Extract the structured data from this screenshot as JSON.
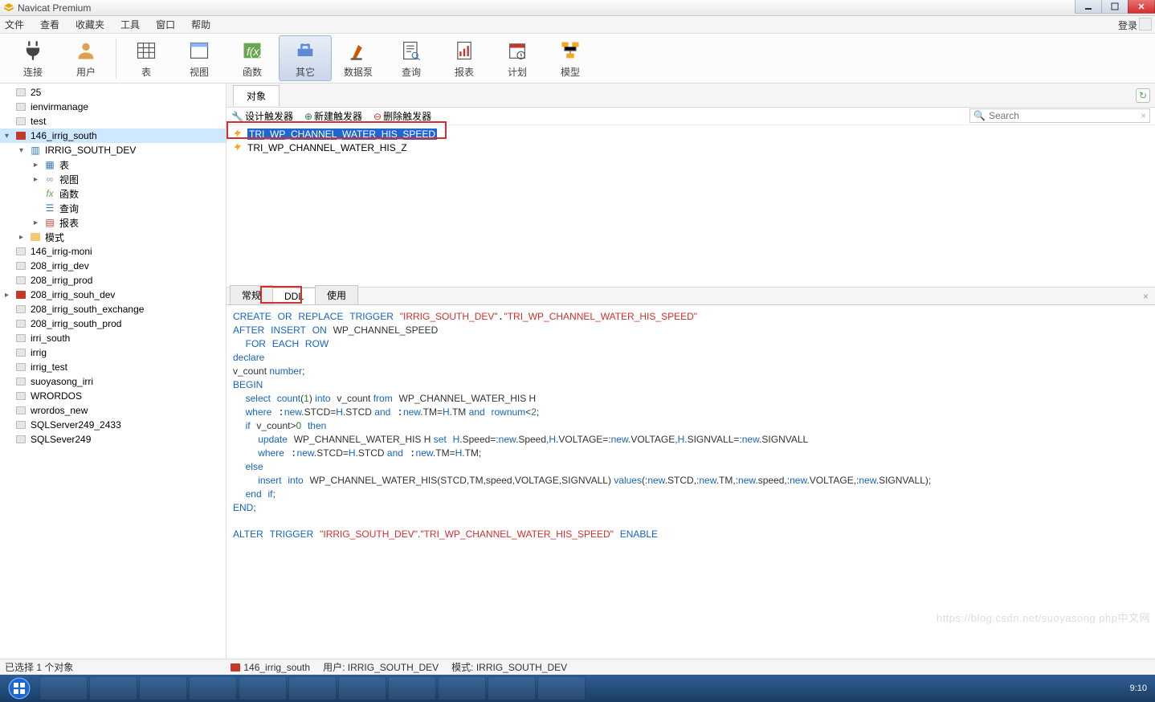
{
  "window": {
    "title": "Navicat Premium"
  },
  "menu": {
    "items": [
      "文件",
      "查看",
      "收藏夹",
      "工具",
      "窗口",
      "帮助"
    ],
    "login": "登录"
  },
  "toolbar": {
    "items": [
      {
        "label": "连接",
        "icon": "plug-icon"
      },
      {
        "label": "用户",
        "icon": "user-icon"
      },
      {
        "label": "表",
        "icon": "table-icon"
      },
      {
        "label": "视图",
        "icon": "view-icon"
      },
      {
        "label": "函数",
        "icon": "fx-icon"
      },
      {
        "label": "其它",
        "icon": "other-icon",
        "active": true
      },
      {
        "label": "数据泵",
        "icon": "pump-icon"
      },
      {
        "label": "查询",
        "icon": "query-icon"
      },
      {
        "label": "报表",
        "icon": "report-icon"
      },
      {
        "label": "计划",
        "icon": "schedule-icon"
      },
      {
        "label": "模型",
        "icon": "model-icon"
      }
    ]
  },
  "sidebar": {
    "items": [
      {
        "label": "25",
        "depth": 0,
        "icon": "db-closed"
      },
      {
        "label": "ienvirmanage",
        "depth": 0,
        "icon": "db-closed"
      },
      {
        "label": "test",
        "depth": 0,
        "icon": "db-closed"
      },
      {
        "label": "146_irrig_south",
        "depth": 0,
        "icon": "db-open",
        "arrow": "▾",
        "selected": true
      },
      {
        "label": "IRRIG_SOUTH_DEV",
        "depth": 1,
        "icon": "schema",
        "arrow": "▾"
      },
      {
        "label": "表",
        "depth": 2,
        "icon": "table",
        "arrow": "▸"
      },
      {
        "label": "视图",
        "depth": 2,
        "icon": "view",
        "arrow": "▸"
      },
      {
        "label": "函数",
        "depth": 2,
        "icon": "fx"
      },
      {
        "label": "查询",
        "depth": 2,
        "icon": "query"
      },
      {
        "label": "报表",
        "depth": 2,
        "icon": "report",
        "arrow": "▸"
      },
      {
        "label": "模式",
        "depth": 1,
        "icon": "folder",
        "arrow": "▸"
      },
      {
        "label": "146_irrig-moni",
        "depth": 0,
        "icon": "db-closed"
      },
      {
        "label": "208_irrig_dev",
        "depth": 0,
        "icon": "db-closed"
      },
      {
        "label": "208_irrig_prod",
        "depth": 0,
        "icon": "db-closed"
      },
      {
        "label": "208_irrig_souh_dev",
        "depth": 0,
        "icon": "db-open",
        "arrow": "▸"
      },
      {
        "label": "208_irrig_south_exchange",
        "depth": 0,
        "icon": "db-closed"
      },
      {
        "label": "208_irrig_south_prod",
        "depth": 0,
        "icon": "db-closed"
      },
      {
        "label": "irri_south",
        "depth": 0,
        "icon": "db-closed"
      },
      {
        "label": "irrig",
        "depth": 0,
        "icon": "db-closed"
      },
      {
        "label": "irrig_test",
        "depth": 0,
        "icon": "db-closed"
      },
      {
        "label": "suoyasong_irri",
        "depth": 0,
        "icon": "db-closed"
      },
      {
        "label": "WRORDOS",
        "depth": 0,
        "icon": "db-closed"
      },
      {
        "label": "wrordos_new",
        "depth": 0,
        "icon": "db-closed"
      },
      {
        "label": "SQLServer249_2433",
        "depth": 0,
        "icon": "db-closed"
      },
      {
        "label": "SQLSever249",
        "depth": 0,
        "icon": "db-closed"
      }
    ]
  },
  "main": {
    "tab": "对象",
    "actions": {
      "design": "设计触发器",
      "new": "新建触发器",
      "delete": "删除触发器"
    },
    "search_placeholder": "Search",
    "triggers": [
      {
        "name": "TRI_WP_CHANNEL_WATER_HIS_SPEED",
        "selected": true
      },
      {
        "name": "TRI_WP_CHANNEL_WATER_HIS_Z",
        "selected": false
      }
    ],
    "detail_tabs": {
      "general": "常规",
      "ddl": "DDL",
      "use": "使用"
    },
    "ddl_tokens": [
      [
        "kw",
        "CREATE"
      ],
      [
        "sp",
        " "
      ],
      [
        "kw",
        "OR"
      ],
      [
        "sp",
        " "
      ],
      [
        "kw",
        "REPLACE"
      ],
      [
        "sp",
        " "
      ],
      [
        "kw",
        "TRIGGER"
      ],
      [
        "sp",
        " "
      ],
      [
        "str",
        "\"IRRIG_SOUTH_DEV\""
      ],
      [
        "sp",
        "."
      ],
      [
        "str",
        "\"TRI_WP_CHANNEL_WATER_HIS_SPEED\""
      ],
      [
        "nl"
      ],
      [
        "kw",
        "AFTER"
      ],
      [
        "sp",
        " "
      ],
      [
        "kw",
        "INSERT"
      ],
      [
        "sp",
        " "
      ],
      [
        "kw",
        "ON"
      ],
      [
        "sp",
        " "
      ],
      [
        "ident",
        "WP_CHANNEL_SPEED"
      ],
      [
        "nl"
      ],
      [
        "sp",
        "  "
      ],
      [
        "kw",
        "FOR"
      ],
      [
        "sp",
        " "
      ],
      [
        "kw",
        "EACH"
      ],
      [
        "sp",
        " "
      ],
      [
        "kw",
        "ROW"
      ],
      [
        "nl"
      ],
      [
        "kw",
        "declare"
      ],
      [
        "nl"
      ],
      [
        "ident",
        "v_count "
      ],
      [
        "kw",
        "number"
      ],
      [
        "ident",
        ";"
      ],
      [
        "nl"
      ],
      [
        "kw",
        "BEGIN"
      ],
      [
        "nl"
      ],
      [
        "sp",
        "  "
      ],
      [
        "kw",
        "select"
      ],
      [
        "sp",
        " "
      ],
      [
        "kw",
        "count"
      ],
      [
        "ident",
        "("
      ],
      [
        "num",
        "1"
      ],
      [
        "ident",
        ") "
      ],
      [
        "kw",
        "into"
      ],
      [
        "sp",
        " "
      ],
      [
        "ident",
        "v_count "
      ],
      [
        "kw",
        "from"
      ],
      [
        "sp",
        " "
      ],
      [
        "ident",
        "WP_CHANNEL_WATER_HIS H"
      ],
      [
        "nl"
      ],
      [
        "sp",
        "  "
      ],
      [
        "kw",
        "where"
      ],
      [
        "sp",
        " :"
      ],
      [
        "kw",
        "new"
      ],
      [
        "ident",
        ".STCD="
      ],
      [
        "kw",
        "H"
      ],
      [
        "ident",
        ".STCD "
      ],
      [
        "kw",
        "and"
      ],
      [
        "sp",
        " :"
      ],
      [
        "kw",
        "new"
      ],
      [
        "ident",
        ".TM="
      ],
      [
        "kw",
        "H"
      ],
      [
        "ident",
        ".TM "
      ],
      [
        "kw",
        "and"
      ],
      [
        "sp",
        " "
      ],
      [
        "kw",
        "rownum"
      ],
      [
        "ident",
        "<"
      ],
      [
        "num",
        "2"
      ],
      [
        "ident",
        ";"
      ],
      [
        "nl"
      ],
      [
        "sp",
        "  "
      ],
      [
        "kw",
        "if"
      ],
      [
        "sp",
        " "
      ],
      [
        "ident",
        "v_count>"
      ],
      [
        "num",
        "0"
      ],
      [
        "sp",
        " "
      ],
      [
        "kw",
        "then"
      ],
      [
        "nl"
      ],
      [
        "sp",
        "    "
      ],
      [
        "kw",
        "update"
      ],
      [
        "sp",
        " "
      ],
      [
        "ident",
        "WP_CHANNEL_WATER_HIS H "
      ],
      [
        "kw",
        "set"
      ],
      [
        "sp",
        " "
      ],
      [
        "kw",
        "H"
      ],
      [
        "ident",
        ".Speed=:"
      ],
      [
        "kw",
        "new"
      ],
      [
        "ident",
        ".Speed,"
      ],
      [
        "kw",
        "H"
      ],
      [
        "ident",
        ".VOLTAGE=:"
      ],
      [
        "kw",
        "new"
      ],
      [
        "ident",
        ".VOLTAGE,"
      ],
      [
        "kw",
        "H"
      ],
      [
        "ident",
        ".SIGNVALL=:"
      ],
      [
        "kw",
        "new"
      ],
      [
        "ident",
        ".SIGNVALL"
      ],
      [
        "nl"
      ],
      [
        "sp",
        "    "
      ],
      [
        "kw",
        "where"
      ],
      [
        "sp",
        " :"
      ],
      [
        "kw",
        "new"
      ],
      [
        "ident",
        ".STCD="
      ],
      [
        "kw",
        "H"
      ],
      [
        "ident",
        ".STCD "
      ],
      [
        "kw",
        "and"
      ],
      [
        "sp",
        " :"
      ],
      [
        "kw",
        "new"
      ],
      [
        "ident",
        ".TM="
      ],
      [
        "kw",
        "H"
      ],
      [
        "ident",
        ".TM;"
      ],
      [
        "nl"
      ],
      [
        "sp",
        "  "
      ],
      [
        "kw",
        "else"
      ],
      [
        "nl"
      ],
      [
        "sp",
        "    "
      ],
      [
        "kw",
        "insert"
      ],
      [
        "sp",
        " "
      ],
      [
        "kw",
        "into"
      ],
      [
        "sp",
        " "
      ],
      [
        "ident",
        "WP_CHANNEL_WATER_HIS(STCD,TM,speed,VOLTAGE,SIGNVALL) "
      ],
      [
        "kw",
        "values"
      ],
      [
        "ident",
        "(:"
      ],
      [
        "kw",
        "new"
      ],
      [
        "ident",
        ".STCD,:"
      ],
      [
        "kw",
        "new"
      ],
      [
        "ident",
        ".TM,:"
      ],
      [
        "kw",
        "new"
      ],
      [
        "ident",
        ".speed,:"
      ],
      [
        "kw",
        "new"
      ],
      [
        "ident",
        ".VOLTAGE,:"
      ],
      [
        "kw",
        "new"
      ],
      [
        "ident",
        ".SIGNVALL);"
      ],
      [
        "nl"
      ],
      [
        "sp",
        "  "
      ],
      [
        "kw",
        "end"
      ],
      [
        "sp",
        " "
      ],
      [
        "kw",
        "if"
      ],
      [
        "ident",
        ";"
      ],
      [
        "nl"
      ],
      [
        "kw",
        "END"
      ],
      [
        "ident",
        ";"
      ],
      [
        "nl"
      ],
      [
        "nl"
      ],
      [
        "kw",
        "ALTER"
      ],
      [
        "sp",
        " "
      ],
      [
        "kw",
        "TRIGGER"
      ],
      [
        "sp",
        " "
      ],
      [
        "str",
        "\"IRRIG_SOUTH_DEV\""
      ],
      [
        "ident",
        "."
      ],
      [
        "str",
        "\"TRI_WP_CHANNEL_WATER_HIS_SPEED\""
      ],
      [
        "sp",
        " "
      ],
      [
        "kw",
        "ENABLE"
      ]
    ]
  },
  "status": {
    "selected": "已选择 1 个对象",
    "db": "146_irrig_south",
    "user_label": "用户:",
    "user": "IRRIG_SOUTH_DEV",
    "mode_label": "模式:",
    "mode": "IRRIG_SOUTH_DEV"
  },
  "watermark": "https://blog.csdn.net/suoyasong  php中文网",
  "taskbar": {
    "time": "9:10"
  }
}
